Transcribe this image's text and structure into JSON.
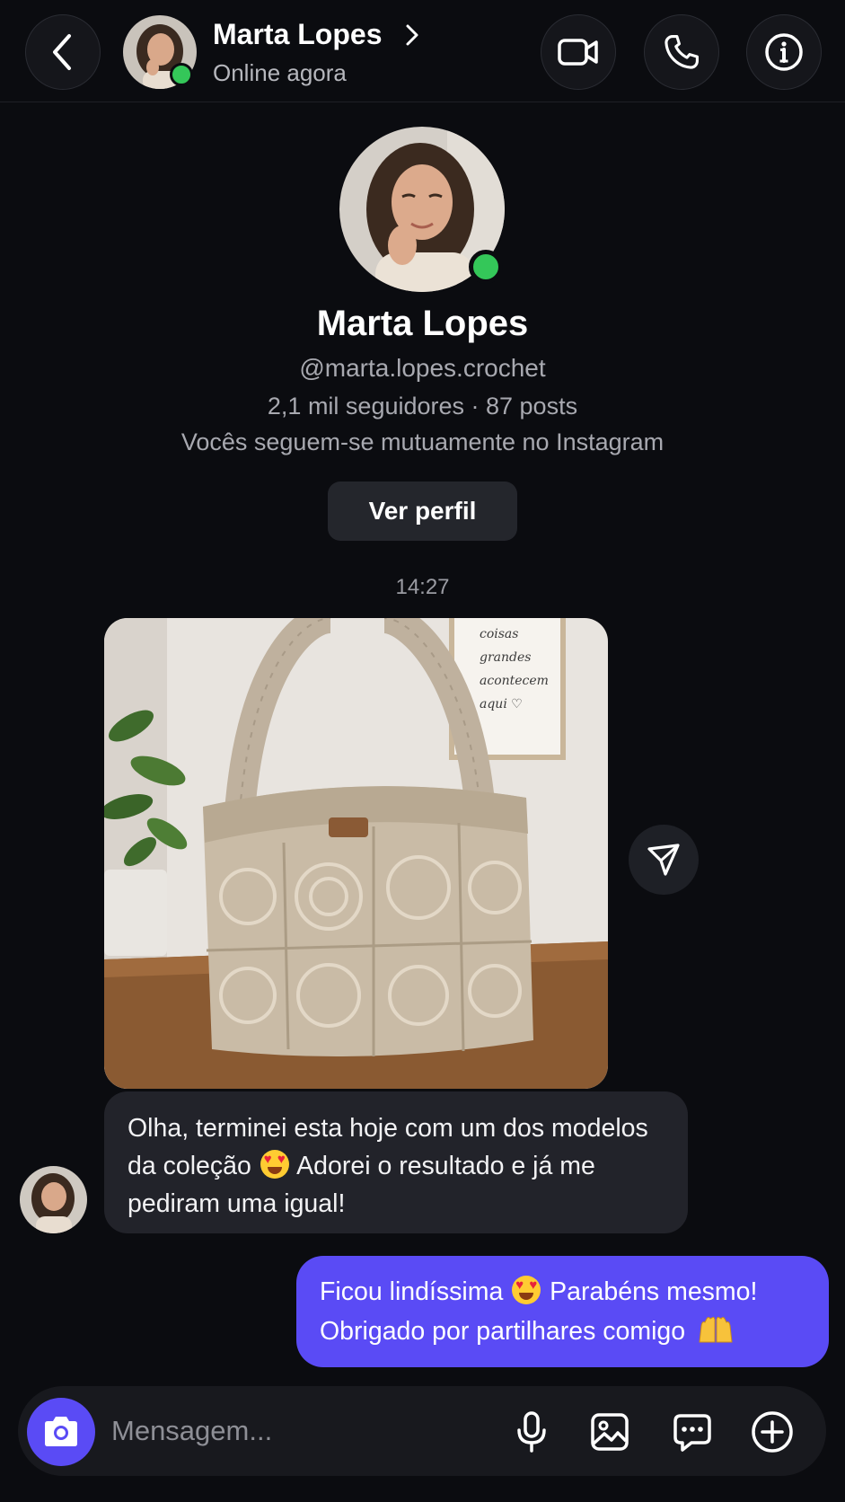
{
  "header": {
    "contact_name": "Marta Lopes",
    "status": "Online agora"
  },
  "profile": {
    "name": "Marta Lopes",
    "handle": "@marta.lopes.crochet",
    "stats": "2,1 mil seguidores · 87 posts",
    "mutual": "Vocês seguem-se mutuamente no Instagram",
    "view_profile_label": "Ver perfil"
  },
  "conversation": {
    "timestamp": "14:27",
    "photo_sign_text": [
      "coisas",
      "grandes",
      "acontecem",
      "aqui ♡"
    ],
    "incoming": {
      "part1": "Olha, terminei esta hoje com um dos modelos da coleção",
      "emoji1": "😍",
      "part2": "Adorei o resultado e já me pediram uma igual!"
    },
    "outgoing": {
      "part1": "Ficou lindíssima",
      "emoji1": "😍",
      "part2": "Parabéns mesmo! Obrigado por partilhares comigo",
      "emoji2": "🙌"
    }
  },
  "composer": {
    "placeholder": "Mensagem..."
  },
  "colors": {
    "background": "#0b0c10",
    "accent": "#5a4bf5",
    "online": "#34c759",
    "incoming_bubble": "#22232a"
  },
  "icons": [
    "chevron-left-icon",
    "video-icon",
    "phone-icon",
    "info-icon",
    "chevron-right-icon",
    "send-icon",
    "camera-icon",
    "mic-icon",
    "gallery-icon",
    "sticker-icon",
    "plus-icon"
  ]
}
